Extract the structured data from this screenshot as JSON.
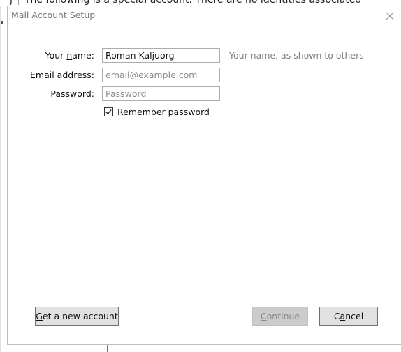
{
  "background": {
    "window_title_fragment": "j",
    "message_fragment": "The following is a special account. There are no identities associated"
  },
  "dialog": {
    "title": "Mail Account Setup",
    "close_icon": "close-icon",
    "fields": {
      "name": {
        "label_pre": "Your ",
        "label_accel": "n",
        "label_post": "ame:",
        "value": "Roman Kaljuorg",
        "hint": "Your name, as shown to others"
      },
      "email": {
        "label_pre": "Emai",
        "label_accel": "l",
        "label_post": " address:",
        "value": "",
        "placeholder": "email@example.com"
      },
      "password": {
        "label_pre": "",
        "label_accel": "P",
        "label_post": "assword:",
        "value": "",
        "placeholder": "Password"
      }
    },
    "remember": {
      "label_pre": "Re",
      "label_accel": "m",
      "label_post": "ember password",
      "checked": true
    },
    "buttons": {
      "get_account": {
        "accel": "G",
        "rest": "et a new account"
      },
      "continue": {
        "accel": "C",
        "rest": "ontinue",
        "disabled": true
      },
      "cancel": {
        "pre": "C",
        "accel": "a",
        "rest": "ncel"
      }
    }
  },
  "colors": {
    "title_text": "#777777",
    "hint_text": "#808080",
    "button_bg": "#e1e1e1",
    "button_border": "#707070",
    "disabled_bg": "#cccccc",
    "disabled_text": "#8a8a8a"
  }
}
